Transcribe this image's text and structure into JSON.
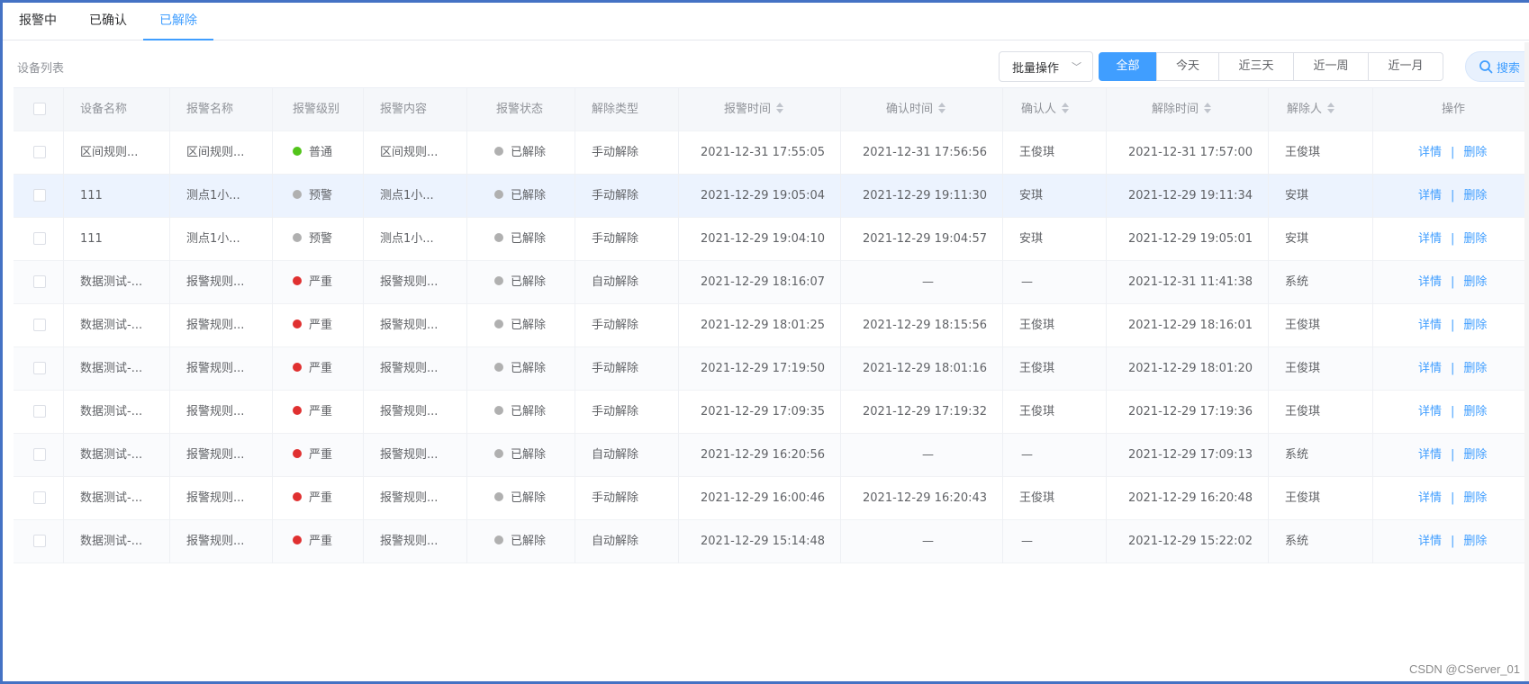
{
  "tabs": [
    "报警中",
    "已确认",
    "已解除"
  ],
  "active_tab": 2,
  "toolbar": {
    "list_title": "设备列表",
    "batch_label": "批量操作",
    "ranges": [
      "全部",
      "今天",
      "近三天",
      "近一周",
      "近一月"
    ],
    "search_label": "搜索"
  },
  "table": {
    "headers": [
      "",
      "设备名称",
      "报警名称",
      "报警级别",
      "报警内容",
      "报警状态",
      "解除类型",
      "报警时间",
      "确认时间",
      "确认人",
      "解除时间",
      "解除人",
      "操作"
    ],
    "detail_label": "详情",
    "delete_label": "删除",
    "divider": "|",
    "rows": [
      {
        "device": "区间规则...",
        "alarm": "区间规则...",
        "level": "普通",
        "level_color": "#52c41a",
        "content": "区间规则...",
        "status": "已解除",
        "release_type": "手动解除",
        "alarm_time": "2021-12-31 17:55:05",
        "confirm_time": "2021-12-31 17:56:56",
        "confirmer": "王俊琪",
        "release_time": "2021-12-31 17:57:00",
        "releaser": "王俊琪"
      },
      {
        "device": "111",
        "alarm": "测点1小...",
        "level": "预警",
        "level_color": "#b0b0b0",
        "content": "测点1小...",
        "status": "已解除",
        "release_type": "手动解除",
        "alarm_time": "2021-12-29 19:05:04",
        "confirm_time": "2021-12-29 19:11:30",
        "confirmer": "安琪",
        "release_time": "2021-12-29 19:11:34",
        "releaser": "安琪"
      },
      {
        "device": "111",
        "alarm": "测点1小...",
        "level": "预警",
        "level_color": "#b0b0b0",
        "content": "测点1小...",
        "status": "已解除",
        "release_type": "手动解除",
        "alarm_time": "2021-12-29 19:04:10",
        "confirm_time": "2021-12-29 19:04:57",
        "confirmer": "安琪",
        "release_time": "2021-12-29 19:05:01",
        "releaser": "安琪"
      },
      {
        "device": "数据测试-...",
        "alarm": "报警规则...",
        "level": "严重",
        "level_color": "#e03030",
        "content": "报警规则...",
        "status": "已解除",
        "release_type": "自动解除",
        "alarm_time": "2021-12-29 18:16:07",
        "confirm_time": "—",
        "confirmer": "—",
        "release_time": "2021-12-31 11:41:38",
        "releaser": "系统"
      },
      {
        "device": "数据测试-...",
        "alarm": "报警规则...",
        "level": "严重",
        "level_color": "#e03030",
        "content": "报警规则...",
        "status": "已解除",
        "release_type": "手动解除",
        "alarm_time": "2021-12-29 18:01:25",
        "confirm_time": "2021-12-29 18:15:56",
        "confirmer": "王俊琪",
        "release_time": "2021-12-29 18:16:01",
        "releaser": "王俊琪"
      },
      {
        "device": "数据测试-...",
        "alarm": "报警规则...",
        "level": "严重",
        "level_color": "#e03030",
        "content": "报警规则...",
        "status": "已解除",
        "release_type": "手动解除",
        "alarm_time": "2021-12-29 17:19:50",
        "confirm_time": "2021-12-29 18:01:16",
        "confirmer": "王俊琪",
        "release_time": "2021-12-29 18:01:20",
        "releaser": "王俊琪"
      },
      {
        "device": "数据测试-...",
        "alarm": "报警规则...",
        "level": "严重",
        "level_color": "#e03030",
        "content": "报警规则...",
        "status": "已解除",
        "release_type": "手动解除",
        "alarm_time": "2021-12-29 17:09:35",
        "confirm_time": "2021-12-29 17:19:32",
        "confirmer": "王俊琪",
        "release_time": "2021-12-29 17:19:36",
        "releaser": "王俊琪"
      },
      {
        "device": "数据测试-...",
        "alarm": "报警规则...",
        "level": "严重",
        "level_color": "#e03030",
        "content": "报警规则...",
        "status": "已解除",
        "release_type": "自动解除",
        "alarm_time": "2021-12-29 16:20:56",
        "confirm_time": "—",
        "confirmer": "—",
        "release_time": "2021-12-29 17:09:13",
        "releaser": "系统"
      },
      {
        "device": "数据测试-...",
        "alarm": "报警规则...",
        "level": "严重",
        "level_color": "#e03030",
        "content": "报警规则...",
        "status": "已解除",
        "release_type": "手动解除",
        "alarm_time": "2021-12-29 16:00:46",
        "confirm_time": "2021-12-29 16:20:43",
        "confirmer": "王俊琪",
        "release_time": "2021-12-29 16:20:48",
        "releaser": "王俊琪"
      },
      {
        "device": "数据测试-...",
        "alarm": "报警规则...",
        "level": "严重",
        "level_color": "#e03030",
        "content": "报警规则...",
        "status": "已解除",
        "release_type": "自动解除",
        "alarm_time": "2021-12-29 15:14:48",
        "confirm_time": "—",
        "confirmer": "—",
        "release_time": "2021-12-29 15:22:02",
        "releaser": "系统"
      }
    ]
  },
  "status_color": "#b0b0b0",
  "accent_color": "#409eff",
  "credit": "CSDN @CServer_01"
}
